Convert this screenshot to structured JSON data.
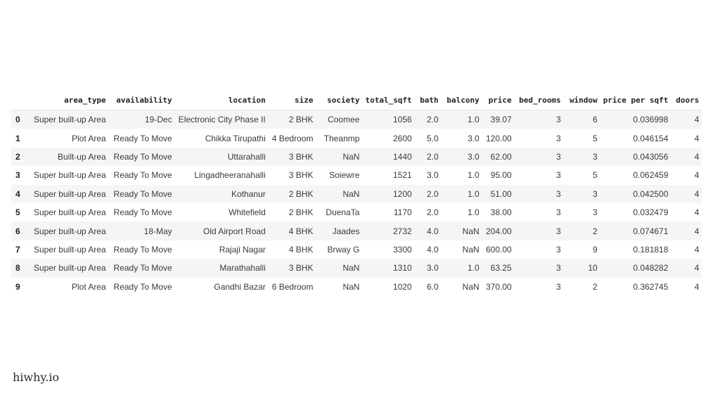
{
  "table": {
    "columns": [
      "area_type",
      "availability",
      "location",
      "size",
      "society",
      "total_sqft",
      "bath",
      "balcony",
      "price",
      "bed_rooms",
      "window",
      "price per sqft",
      "doors"
    ],
    "rows": [
      {
        "index": "0",
        "cells": [
          "Super built-up Area",
          "19-Dec",
          "Electronic City Phase II",
          "2 BHK",
          "Coomee",
          "1056",
          "2.0",
          "1.0",
          "39.07",
          "3",
          "6",
          "0.036998",
          "4"
        ]
      },
      {
        "index": "1",
        "cells": [
          "Plot Area",
          "Ready To Move",
          "Chikka Tirupathi",
          "4 Bedroom",
          "Theanmp",
          "2600",
          "5.0",
          "3.0",
          "120.00",
          "3",
          "5",
          "0.046154",
          "4"
        ]
      },
      {
        "index": "2",
        "cells": [
          "Built-up Area",
          "Ready To Move",
          "Uttarahalli",
          "3 BHK",
          "NaN",
          "1440",
          "2.0",
          "3.0",
          "62.00",
          "3",
          "3",
          "0.043056",
          "4"
        ]
      },
      {
        "index": "3",
        "cells": [
          "Super built-up Area",
          "Ready To Move",
          "Lingadheeranahalli",
          "3 BHK",
          "Soiewre",
          "1521",
          "3.0",
          "1.0",
          "95.00",
          "3",
          "5",
          "0.062459",
          "4"
        ]
      },
      {
        "index": "4",
        "cells": [
          "Super built-up Area",
          "Ready To Move",
          "Kothanur",
          "2 BHK",
          "NaN",
          "1200",
          "2.0",
          "1.0",
          "51.00",
          "3",
          "3",
          "0.042500",
          "4"
        ]
      },
      {
        "index": "5",
        "cells": [
          "Super built-up Area",
          "Ready To Move",
          "Whitefield",
          "2 BHK",
          "DuenaTa",
          "1170",
          "2.0",
          "1.0",
          "38.00",
          "3",
          "3",
          "0.032479",
          "4"
        ]
      },
      {
        "index": "6",
        "cells": [
          "Super built-up Area",
          "18-May",
          "Old Airport Road",
          "4 BHK",
          "Jaades",
          "2732",
          "4.0",
          "NaN",
          "204.00",
          "3",
          "2",
          "0.074671",
          "4"
        ]
      },
      {
        "index": "7",
        "cells": [
          "Super built-up Area",
          "Ready To Move",
          "Rajaji Nagar",
          "4 BHK",
          "Brway G",
          "3300",
          "4.0",
          "NaN",
          "600.00",
          "3",
          "9",
          "0.181818",
          "4"
        ]
      },
      {
        "index": "8",
        "cells": [
          "Super built-up Area",
          "Ready To Move",
          "Marathahalli",
          "3 BHK",
          "NaN",
          "1310",
          "3.0",
          "1.0",
          "63.25",
          "3",
          "10",
          "0.048282",
          "4"
        ]
      },
      {
        "index": "9",
        "cells": [
          "Plot Area",
          "Ready To Move",
          "Gandhi Bazar",
          "6 Bedroom",
          "NaN",
          "1020",
          "6.0",
          "NaN",
          "370.00",
          "3",
          "2",
          "0.362745",
          "4"
        ]
      }
    ]
  },
  "watermark": "hiwhy.io"
}
